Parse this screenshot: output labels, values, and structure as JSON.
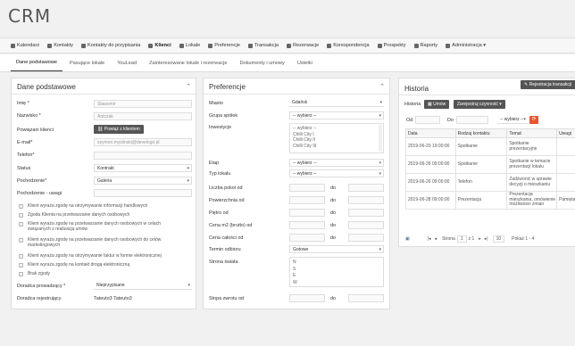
{
  "brand": "CRM",
  "nav": [
    {
      "label": "Kalendarz",
      "icon": "calendar-icon"
    },
    {
      "label": "Kontakty",
      "icon": "phone-icon"
    },
    {
      "label": "Kontakty do przypisania",
      "icon": "phone-icon"
    },
    {
      "label": "Klienci",
      "icon": "users-icon",
      "active": true
    },
    {
      "label": "Lokale",
      "icon": "building-icon"
    },
    {
      "label": "Preferencje",
      "icon": "tags-icon"
    },
    {
      "label": "Transakcja",
      "icon": "file-icon"
    },
    {
      "label": "Rezerwacje",
      "icon": "lock-icon"
    },
    {
      "label": "Korespondencja",
      "icon": "envelope-icon"
    },
    {
      "label": "Prospekty",
      "icon": "folder-icon"
    },
    {
      "label": "Raporty",
      "icon": "chart-icon"
    },
    {
      "label": "Administracja ▾",
      "icon": "cog-icon"
    }
  ],
  "subtabs": [
    {
      "label": "Dane podstawowe",
      "active": true
    },
    {
      "label": "Pasujące lokale"
    },
    {
      "label": "YouLead"
    },
    {
      "label": "Zainteresowane lokale i rezerwacje"
    },
    {
      "label": "Dokumenty i umowy"
    },
    {
      "label": "Ustetki"
    }
  ],
  "dane": {
    "title": "Dane podstawowe",
    "imie_label": "Imię *",
    "imie_value": "Sławomir",
    "nazwisko_label": "Nazwisko *",
    "nazwisko_value": "Antczak",
    "powiazani_label": "Powiązani klienci",
    "powiaz_button": "Powiąż z klientem",
    "email_label": "E-mail*",
    "email_value": "szymon.myslinski@develogo.pl",
    "telefon_label": "Telefon*",
    "status_label": "Status",
    "status_value": "Kontrakt",
    "pochodzenie_label": "Pochodzenie*",
    "pochodzenie_value": "Galeria",
    "uwagi_label": "Pochodzenie - uwagi",
    "consents": [
      "Klient wyraża zgodę na otrzymywanie informacji handlowych",
      "Zgoda Klienta na przetwarzanie danych osobowych",
      "Klient wyraża zgodę na przetwarzanie danych osobowych w celach związanych z realizacją umów",
      "Klient wyraża zgodę na przetwarzanie danych osobowych do celów marketingowych",
      "Klient wyraża zgodę na otrzymywanie faktur w formie elektronicznej",
      "Klient wyraża zgodę na kontakt drogą elektroniczną",
      "Brak zgody"
    ],
    "doradca_label": "Doradca prowadzący *",
    "doradca_value": "Nieprzypisane",
    "rejestr_label": "Doradca rejestrujący",
    "rejestr_value": "Tateuto3 Tateuto3"
  },
  "pref": {
    "title": "Preferencje",
    "miasto_label": "Miasto",
    "miasto_value": "Gdańsk",
    "grupa_label": "Grupa spółek",
    "grupa_value": "-- wybierz --",
    "inwestycje_label": "Inwestycje",
    "inwestycje_options": [
      "-- wybierz --",
      "Chilli City I",
      "Chilli City II",
      "Chilli City III"
    ],
    "etap_label": "Etap",
    "etap_value": "-- wybierz --",
    "typ_label": "Typ lokalu",
    "typ_value": "-- wybierz --",
    "pokoje_label": "Liczba pokoi od",
    "pow_label": "Powierzchnia od",
    "pietro_label": "Piętro od",
    "cenam2_label": "Cena m2 (brutto) od",
    "cenacal_label": "Cena całości od",
    "do_label": "do",
    "termin_label": "Termin odbioru",
    "termin_value": "Gotowe",
    "strona_label": "Strona świata",
    "strona_options": [
      "N",
      "S",
      "E",
      "W"
    ],
    "stopa_label": "Stopa zwrotu od"
  },
  "hist": {
    "title": "Historia",
    "register_button": "Rejestracja transakcji",
    "tab_label": "Historia",
    "umow_button": "Umów",
    "zamknij_button": "Zarejestruj czynność",
    "od_label": "Od",
    "do_label": "Do",
    "wybierz_value": "-- wybierz --",
    "refresh_symbol": "⟳",
    "columns": [
      "Data",
      "Rodzaj kontaktu",
      "Temat",
      "Uwagi"
    ],
    "rows": [
      [
        "2019-06-20 19:00:00",
        "Spotkanie",
        "Spotkanie prezentacyjne",
        ""
      ],
      [
        "2019-06-26 09:00:00",
        "Spotkanie",
        "Spotkanie w temacie prezentacji lokalu",
        ""
      ],
      [
        "2019-06-26 09:00:00",
        "Telefon",
        "Zadzwonić w sprawie decyzji o mieszkaniu",
        ""
      ],
      [
        "2019-06-28 09:00:00",
        "Prezentacja",
        "Prezentacja mieszkania, omówienie możliwości zmian",
        "Pamiętaj"
      ]
    ],
    "pager_strona": "Strona",
    "pager_page": "1",
    "pager_of": "z 1",
    "pager_size": "10",
    "pager_info": "Pokaż 1 - 4"
  }
}
